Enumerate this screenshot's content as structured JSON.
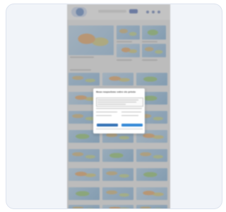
{
  "cookie_dialog": {
    "title": "Nous respectons votre vie privée",
    "deny_label": "",
    "accept_label": ""
  },
  "colors": {
    "card_background": "#f1f4f9",
    "card_border": "#dde3ee",
    "dialog_primary": "#2f6fb5",
    "dialog_accept": "#2f86d6",
    "overlay": "#3c3c3c"
  },
  "icons": [
    "site-logo-icon",
    "nav-icon",
    "search-button-icon"
  ]
}
